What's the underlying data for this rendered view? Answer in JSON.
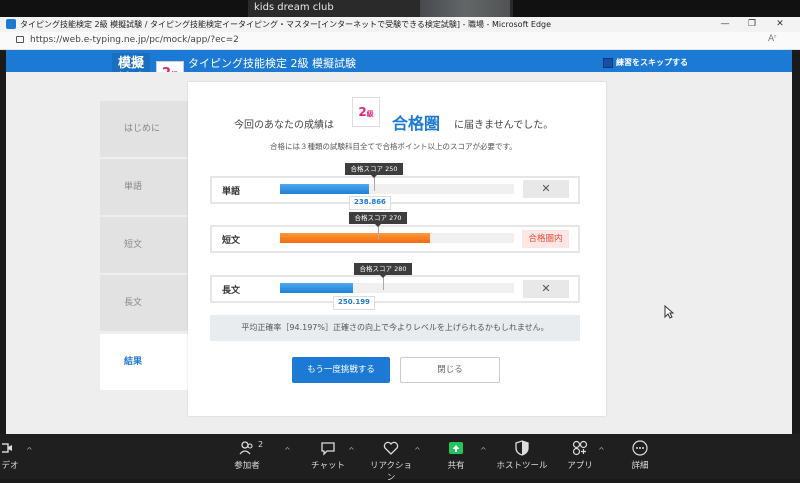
{
  "zoom_top": {
    "participant_name": "kids dream club"
  },
  "edge": {
    "title": "タイピング技能検定 2級 模擬試験 / タイピング技能検定イータイピング・マスター[インターネットで受験できる検定試験] - 職場 - Microsoft Edge",
    "url": "https://web.e-typing.ne.jp/pc/mock/app/?ec=2",
    "minimize": "—",
    "maximize": "❐",
    "close": "✕",
    "reader_icon": "Aʳ"
  },
  "site": {
    "logo_line1": "模擬",
    "logo_line2": "試験",
    "level_num": "2",
    "level_unit": "級",
    "title": "タイピング技能検定 2級 模擬試験",
    "skip_label": "練習をスキップする"
  },
  "sidebar": {
    "items": [
      {
        "label": "はじめに"
      },
      {
        "label": "単語"
      },
      {
        "label": "短文"
      },
      {
        "label": "長文"
      },
      {
        "label": "結果"
      }
    ]
  },
  "result": {
    "prefix": "今回のあなたの成績は",
    "badge_num": "2",
    "badge_unit": "級",
    "status": "合格圏",
    "suffix": "に届きませんでした。",
    "requirement": "合格には３種類の試験科目全てで合格ポイント以上のスコアが必要です。",
    "rows": [
      {
        "label": "単語",
        "target": "合格スコア 250",
        "score": "238.866",
        "score_fraction": 0.38,
        "target_fraction": 0.4,
        "state": "fail",
        "color": "#2a8ae0"
      },
      {
        "label": "短文",
        "target": "合格スコア 270",
        "score": "",
        "score_fraction": 0.64,
        "target_fraction": 0.42,
        "state": "pass",
        "color": "#f26a10"
      },
      {
        "label": "長文",
        "target": "合格スコア 280",
        "score": "250.199",
        "score_fraction": 0.31,
        "target_fraction": 0.44,
        "state": "fail",
        "color": "#2a8ae0"
      }
    ],
    "fail_mark": "✕",
    "pass_label": "合格圏内",
    "average": "平均正確率［94.197%］正確さの向上で今よりレベルを上げられるかもしれません。",
    "retry_label": "もう一度挑戦する",
    "close_label": "閉じる"
  },
  "zoom_toolbar": {
    "video_label": "デオ",
    "participants_label": "参加者",
    "participants_count": "2",
    "chat_label": "チャット",
    "reactions_label": "リアクション",
    "share_label": "共有",
    "host_tools_label": "ホストツール",
    "apps_label": "アプリ",
    "more_label": "詳細",
    "caret": "^"
  }
}
